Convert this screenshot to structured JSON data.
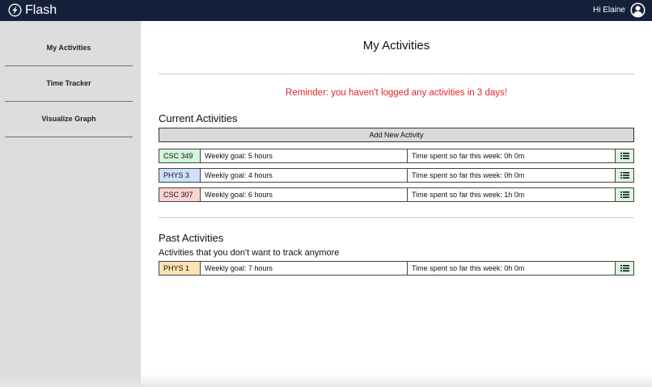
{
  "header": {
    "brand": "Flash",
    "greeting": "Hi Elaine",
    "logo_icon": "lightning-bolt-icon",
    "user_icon": "user-avatar-icon",
    "bg_color": "#15213b"
  },
  "sidebar": {
    "items": [
      {
        "label": "My Activities"
      },
      {
        "label": "Time Tracker"
      },
      {
        "label": "Visualize Graph"
      }
    ]
  },
  "main": {
    "title": "My Activities",
    "reminder": "Reminder: you haven't logged any activities in 3 days!",
    "current": {
      "title": "Current Activities",
      "add_label": "Add New Activity",
      "rows": [
        {
          "name": "CSC 349",
          "goal": "Weekly goal: 5 hours",
          "spent": "Time spent so far this week: 0h 0m",
          "color": "#d3f5dc"
        },
        {
          "name": "PHYS 3",
          "goal": "Weekly goal: 4 hours",
          "spent": "Time spent so far this week: 0h 0m",
          "color": "#cfe0fb"
        },
        {
          "name": "CSC 307",
          "goal": "Weekly goal: 6 hours",
          "spent": "Time spent so far this week: 1h 0m",
          "color": "#fbd3d3"
        }
      ]
    },
    "past": {
      "title": "Past Activities",
      "subtitle": "Activities that you don't want to track anymore",
      "rows": [
        {
          "name": "PHYS 1",
          "goal": "Weekly goal: 7 hours",
          "spent": "Time spent so far this week: 0h 0m",
          "color": "#fde3b3"
        }
      ]
    },
    "menu_icon": "list-icon",
    "menu_bg": "#d9f5e1",
    "reminder_color": "#e0262b"
  }
}
